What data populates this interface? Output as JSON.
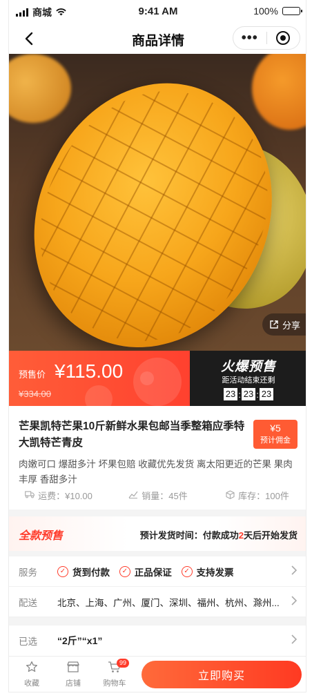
{
  "status_bar": {
    "carrier": "商城",
    "time": "9:41 AM",
    "battery": "100%"
  },
  "nav": {
    "title": "商品详情",
    "more_icon": "•••"
  },
  "hero": {
    "share_label": "分享"
  },
  "price_banner": {
    "presale_label": "预售价",
    "price": "¥115.00",
    "original_price": "¥334.00",
    "hot_title": "火爆预售",
    "countdown_label": "距活动结束还剩",
    "countdown": {
      "h": "23",
      "m": "23",
      "s": "23"
    }
  },
  "product": {
    "title": "芒果凯特芒果10斤新鲜水果包邮当季整箱应季特大凯特芒青皮",
    "commission_amount": "¥5",
    "commission_label": "预计佣金",
    "description": "肉嫩可口 爆甜多汁 坏果包赔 收藏优先发货 离太阳更近的芒果 果肉丰厚 香甜多汁",
    "stats": {
      "shipping": "运费：¥10.00",
      "sales": "销量：45件",
      "stock": "库存：100件"
    }
  },
  "presale_strip": {
    "label": "全款预售",
    "ship_prefix": "预计发货时间：付款成功",
    "ship_days": "2",
    "ship_suffix": "天后开始发货"
  },
  "service_row": {
    "key": "服务",
    "items": [
      "货到付款",
      "正品保证",
      "支持发票"
    ]
  },
  "delivery_row": {
    "key": "配送",
    "value": "北京、上海、广州、厦门、深圳、福州、杭州、滁州..."
  },
  "selected_row": {
    "key": "已选",
    "value": "“2斤”“x1”"
  },
  "tabbar": {
    "favorite": "收藏",
    "shop": "店铺",
    "cart": "购物车",
    "cart_badge": "99",
    "buy_button": "立即购买"
  },
  "colors": {
    "accent": "#ff3b2a",
    "banner_dark": "#1c1c1c"
  }
}
